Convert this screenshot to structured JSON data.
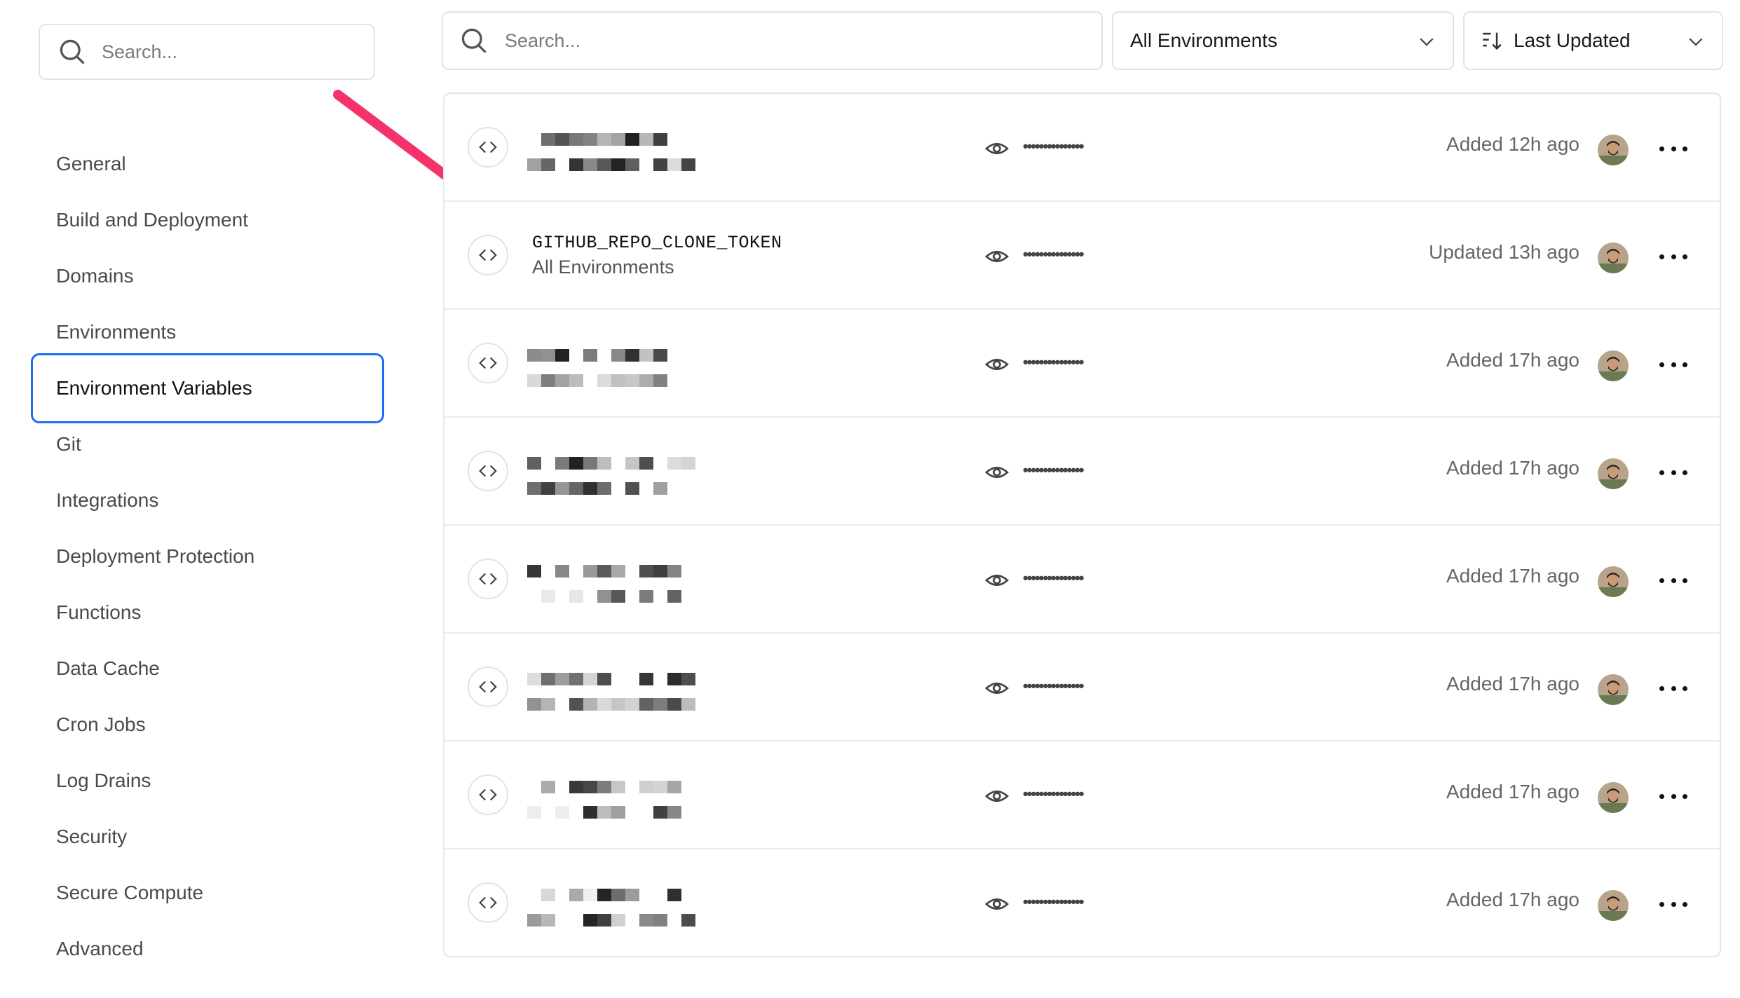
{
  "sidebar": {
    "search_placeholder": "Search...",
    "items": [
      {
        "label": "General"
      },
      {
        "label": "Build and Deployment"
      },
      {
        "label": "Domains"
      },
      {
        "label": "Environments"
      },
      {
        "label": "Environment Variables",
        "active": true
      },
      {
        "label": "Git"
      },
      {
        "label": "Integrations"
      },
      {
        "label": "Deployment Protection"
      },
      {
        "label": "Functions"
      },
      {
        "label": "Data Cache"
      },
      {
        "label": "Cron Jobs"
      },
      {
        "label": "Log Drains"
      },
      {
        "label": "Security"
      },
      {
        "label": "Secure Compute"
      },
      {
        "label": "Advanced"
      }
    ]
  },
  "toolbar": {
    "search_placeholder": "Search...",
    "environment_filter": "All Environments",
    "sort": "Last Updated"
  },
  "variables": [
    {
      "name": "",
      "environment": "",
      "redacted": true,
      "value_mask": "•••••••••••••••",
      "status": "Added 12h ago"
    },
    {
      "name": "GITHUB_REPO_CLONE_TOKEN",
      "environment": "All Environments",
      "redacted": false,
      "value_mask": "•••••••••••••••",
      "status": "Updated 13h ago"
    },
    {
      "name": "",
      "environment": "",
      "redacted": true,
      "value_mask": "•••••••••••••••",
      "status": "Added 17h ago"
    },
    {
      "name": "",
      "environment": "",
      "redacted": true,
      "value_mask": "•••••••••••••••",
      "status": "Added 17h ago"
    },
    {
      "name": "",
      "environment": "",
      "redacted": true,
      "value_mask": "•••••••••••••••",
      "status": "Added 17h ago"
    },
    {
      "name": "",
      "environment": "",
      "redacted": true,
      "value_mask": "•••••••••••••••",
      "status": "Added 17h ago"
    },
    {
      "name": "",
      "environment": "",
      "redacted": true,
      "value_mask": "•••••••••••••••",
      "status": "Added 17h ago"
    },
    {
      "name": "",
      "environment": "",
      "redacted": true,
      "value_mask": "•••••••••••••••",
      "status": "Added 17h ago"
    }
  ],
  "colors": {
    "accent": "#1a6ff5",
    "annotation_arrow": "#f5336b",
    "border": "#e3e3e3"
  },
  "icons": {
    "search": "search-icon",
    "chevron": "chevron-down-icon",
    "sort": "sort-icon",
    "code": "code-icon",
    "eye": "eye-icon",
    "more": "more-icon"
  }
}
